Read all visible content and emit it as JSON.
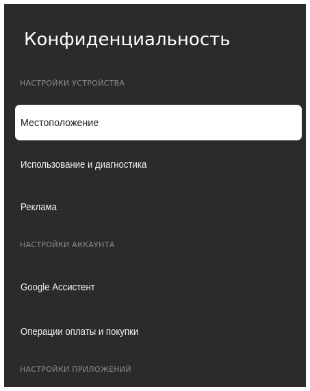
{
  "screen": {
    "title": "Конфиденциальность"
  },
  "sections": [
    {
      "header": "НАСТРОЙКИ УСТРОЙСТВА",
      "items": [
        {
          "label": "Местоположение",
          "selected": true
        },
        {
          "label": "Использование и диагностика",
          "selected": false
        },
        {
          "label": "Реклама",
          "selected": false
        }
      ]
    },
    {
      "header": "НАСТРОЙКИ АККАУНТА",
      "items": [
        {
          "label": "Google Ассистент",
          "selected": false
        },
        {
          "label": "Операции оплаты и покупки",
          "selected": false
        }
      ]
    },
    {
      "header": "НАСТРОЙКИ ПРИЛОЖЕНИЙ",
      "items": []
    }
  ],
  "colors": {
    "panel_background": "#2b2b2b",
    "selected_background": "#ffffff",
    "header_text": "#8a8a8a",
    "item_text": "#f0f0f0",
    "selected_text": "#1c1c1c"
  }
}
